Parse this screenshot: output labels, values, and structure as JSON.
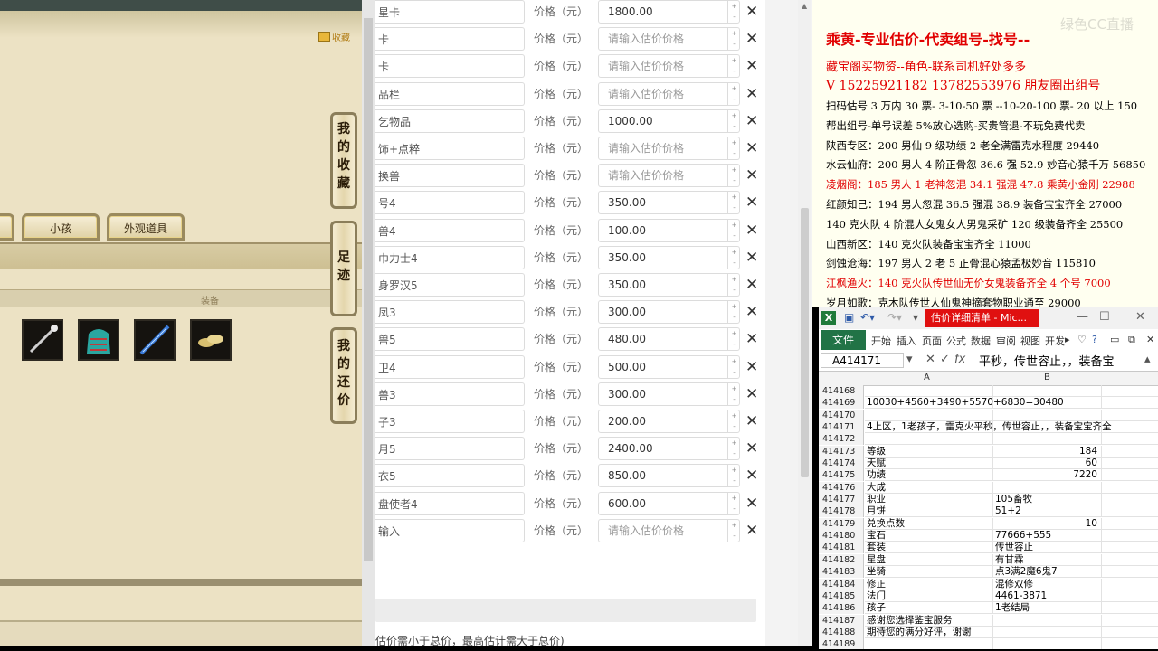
{
  "game": {
    "favorite_label": "收藏",
    "tabs": [
      {
        "label": ""
      },
      {
        "label": "小孩"
      },
      {
        "label": "外观道具"
      }
    ],
    "equipment_header": "装备",
    "side_buttons": [
      "我的收藏",
      "足迹",
      "我的还价"
    ],
    "slots": [
      {
        "icon": "wand-icon",
        "color": "#c8c8c8"
      },
      {
        "icon": "armor-icon",
        "color": "#2aa6a0"
      },
      {
        "icon": "sword-icon",
        "color": "#3a7ad8"
      },
      {
        "icon": "shoes-icon",
        "color": "#d8c070"
      }
    ]
  },
  "form": {
    "price_label": "价格（元）",
    "placeholder": "请输入估价价格",
    "rows": [
      {
        "name": "星卡",
        "value": "1800.00"
      },
      {
        "name": "卡",
        "value": ""
      },
      {
        "name": "卡",
        "value": ""
      },
      {
        "name": "品栏",
        "value": ""
      },
      {
        "name": "乞物品",
        "value": "1000.00"
      },
      {
        "name": "饰+点粹",
        "value": ""
      },
      {
        "name": "换兽",
        "value": ""
      },
      {
        "name": "号4",
        "value": "350.00"
      },
      {
        "name": "兽4",
        "value": "100.00"
      },
      {
        "name": "巾力士4",
        "value": "350.00"
      },
      {
        "name": "身罗汉5",
        "value": "350.00"
      },
      {
        "name": "凤3",
        "value": "300.00"
      },
      {
        "name": "兽5",
        "value": "480.00"
      },
      {
        "name": "卫4",
        "value": "500.00"
      },
      {
        "name": "兽3",
        "value": "300.00"
      },
      {
        "name": "子3",
        "value": "200.00"
      },
      {
        "name": "月5",
        "value": "2400.00"
      },
      {
        "name": "衣5",
        "value": "850.00"
      },
      {
        "name": "盘使者4",
        "value": "600.00"
      },
      {
        "name": "输入",
        "value": ""
      }
    ],
    "note": "估价需小于总价，最高估计需大于总价)"
  },
  "doc": {
    "watermark": "绿色CC直播",
    "headline": "乘黄-专业估价-代卖组号-找号--",
    "subline": "藏宝阁买物资--角色-联系司机好处多多",
    "contact": "V 15225921182   13782553976 朋友圈出组号",
    "lines": [
      {
        "text": "扫码估号 3 万内 30 票- 3-10-50 票  --10-20-100 票- 20 以上 150",
        "red": false
      },
      {
        "text": "帮出组号-单号误差 5%放心选购-买贵管退-不玩免费代卖",
        "red": false
      },
      {
        "text": "陕西专区：200 男仙 9 级功绩 2 老全满雷克水程度 29440",
        "red": false
      },
      {
        "text": "水云仙府：200 男人 4 阶正骨忽 36.6 强 52.9 妙音心猿千万 56850",
        "red": false
      },
      {
        "text": "凌烟阁：185 男人 1 老神忽混 34.1 强混 47.8 乘黄小金刚 22988",
        "red": true
      },
      {
        "text": "红颜知己：194 男人忽混 36.5 强混 38.9 装备宝宝齐全 27000",
        "red": false
      },
      {
        "text": "140 克火队 4 阶混人女鬼女人男鬼采矿 120 级装备齐全 25500",
        "red": false
      },
      {
        "text": "山西新区：140 克火队装备宝宝齐全 11000",
        "red": false
      },
      {
        "text": "剑蚀沧海：197 男人 2 老 5 正骨混心猿孟极妙音 115810",
        "red": false
      },
      {
        "text": "江枫渔火：140 克火队传世仙无价女鬼装备齐全 4 个号 7000",
        "red": true
      },
      {
        "text": "岁月如歌：克木队传世人仙鬼神摘套物职业通至 29000",
        "red": false
      }
    ]
  },
  "excel": {
    "title": "估价详细清单 - Mic...",
    "file_tab": "文件",
    "ribbon_tabs": [
      "开始",
      "插入",
      "页面",
      "公式",
      "数据",
      "审阅",
      "视图",
      "开发"
    ],
    "name_box": "A414171",
    "formula": "平秒，传世容止，，装备宝",
    "col_a": "A",
    "col_b": "B",
    "rows": [
      {
        "n": "414168",
        "a": "",
        "b": "",
        "num": false
      },
      {
        "n": "414169",
        "a": "10030+4560+3490+5570+6830=30480",
        "b": "",
        "num": false
      },
      {
        "n": "414170",
        "a": "",
        "b": "",
        "num": false
      },
      {
        "n": "414171",
        "a": "4上区，1老孩子，雷克火平秒，传世容止，，装备宝宝齐全",
        "b": "",
        "num": false
      },
      {
        "n": "414172",
        "a": "",
        "b": "",
        "num": false
      },
      {
        "n": "414173",
        "a": "等级",
        "b": "184",
        "num": true
      },
      {
        "n": "414174",
        "a": "天赋",
        "b": "60",
        "num": true
      },
      {
        "n": "414175",
        "a": "功绩",
        "b": "7220",
        "num": true
      },
      {
        "n": "414176",
        "a": "大成",
        "b": "",
        "num": false
      },
      {
        "n": "414177",
        "a": "职业",
        "b": "105畜牧",
        "num": false
      },
      {
        "n": "414178",
        "a": "月饼",
        "b": "51+2",
        "num": false
      },
      {
        "n": "414179",
        "a": "兑换点数",
        "b": "10",
        "num": true
      },
      {
        "n": "414180",
        "a": "宝石",
        "b": "77666+555",
        "num": false
      },
      {
        "n": "414181",
        "a": "套装",
        "b": "传世容止",
        "num": false
      },
      {
        "n": "414182",
        "a": "星盘",
        "b": "有甘霖",
        "num": false
      },
      {
        "n": "414183",
        "a": "坐骑",
        "b": "点3满2魔6鬼7",
        "num": false
      },
      {
        "n": "414184",
        "a": "修正",
        "b": "混修双修",
        "num": false
      },
      {
        "n": "414185",
        "a": "法门",
        "b": "4461-3871",
        "num": false
      },
      {
        "n": "414186",
        "a": "孩子",
        "b": "1老结局",
        "num": false
      },
      {
        "n": "414187",
        "a": "感谢您选择鉴宝服务",
        "b": "",
        "num": false
      },
      {
        "n": "414188",
        "a": "期待您的满分好评，谢谢",
        "b": "",
        "num": false
      },
      {
        "n": "414189",
        "a": "",
        "b": "",
        "num": false
      }
    ]
  }
}
